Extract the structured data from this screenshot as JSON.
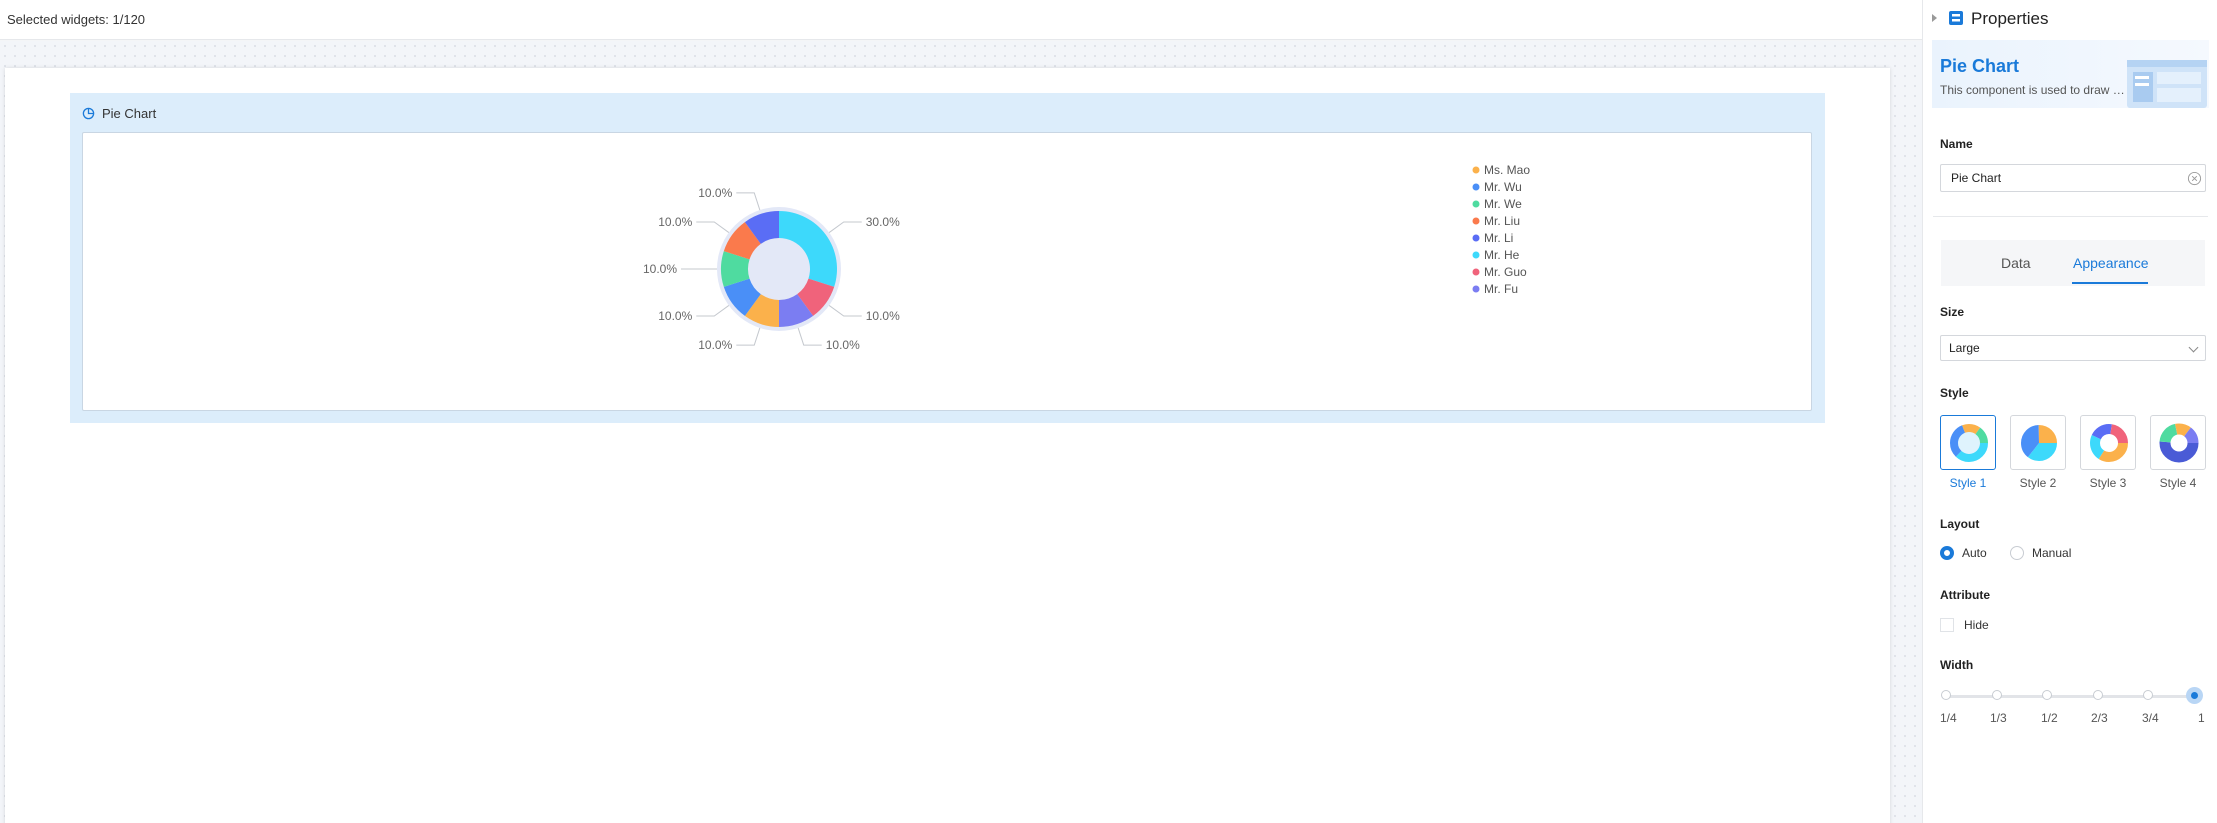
{
  "topbar": {
    "selected_text": "Selected widgets: 1/120"
  },
  "widget": {
    "title": "Pie Chart"
  },
  "chart_data": {
    "type": "pie",
    "style": "donut",
    "categories": [
      "Mr. He",
      "Mr. Guo",
      "Mr. Fu",
      "Ms. Mao",
      "Mr. Wu",
      "Mr. We",
      "Mr. Liu",
      "Mr. Li"
    ],
    "values": [
      30,
      10,
      10,
      10,
      10,
      10,
      10,
      10
    ],
    "labels": [
      "30.0%",
      "10.0%",
      "10.0%",
      "10.0%",
      "10.0%",
      "10.0%",
      "10.0%",
      "10.0%"
    ],
    "colors": [
      "#3dd9fb",
      "#f0637b",
      "#7b7df2",
      "#fbb14b",
      "#4a8ff7",
      "#4fdba0",
      "#fa7a4c",
      "#5a6df5"
    ],
    "legend": {
      "position": "right",
      "items": [
        {
          "name": "Ms. Mao",
          "color": "#fbb14b"
        },
        {
          "name": "Mr. Wu",
          "color": "#4a8ff7"
        },
        {
          "name": "Mr. We",
          "color": "#4fdba0"
        },
        {
          "name": "Mr. Liu",
          "color": "#fa7a4c"
        },
        {
          "name": "Mr. Li",
          "color": "#5a6df5"
        },
        {
          "name": "Mr. He",
          "color": "#3dd9fb"
        },
        {
          "name": "Mr. Guo",
          "color": "#f0637b"
        },
        {
          "name": "Mr. Fu",
          "color": "#7b7df2"
        }
      ]
    }
  },
  "panel": {
    "title": "Properties",
    "card_title": "Pie Chart",
    "card_desc": "This component is used to draw pie charts",
    "name_label": "Name",
    "name_value": "Pie Chart",
    "tabs": [
      {
        "label": "Data"
      },
      {
        "label": "Appearance",
        "active": true
      }
    ],
    "size_label": "Size",
    "size_value": "Large",
    "style_label": "Style",
    "styles": [
      {
        "label": "Style 1",
        "active": true
      },
      {
        "label": "Style 2"
      },
      {
        "label": "Style 3"
      },
      {
        "label": "Style 4"
      }
    ],
    "layout_label": "Layout",
    "layout_options": [
      {
        "label": "Auto",
        "selected": true
      },
      {
        "label": "Manual"
      }
    ],
    "attribute_label": "Attribute",
    "hide_label": "Hide",
    "width_label": "Width",
    "width_ticks": [
      "1/4",
      "1/3",
      "1/2",
      "2/3",
      "3/4",
      "1"
    ],
    "width_value": "1"
  }
}
